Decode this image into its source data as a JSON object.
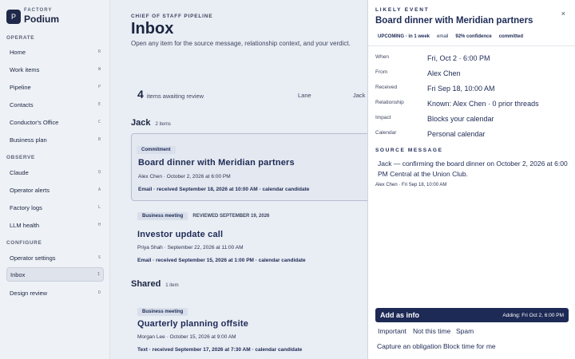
{
  "brand": {
    "logo": "P",
    "kicker": "FACTORY",
    "name": "Podium"
  },
  "sidebar": {
    "operate_label": "OPERATE",
    "observe_label": "OBSERVE",
    "configure_label": "CONFIGURE",
    "items": [
      {
        "label": "Home",
        "key": "R"
      },
      {
        "label": "Work items",
        "key": "W"
      },
      {
        "label": "Pipeline",
        "key": "P"
      },
      {
        "label": "Contacts",
        "key": "E"
      },
      {
        "label": "Conductor's Office",
        "key": "C"
      },
      {
        "label": "Business plan",
        "key": "B"
      },
      {
        "label": "Claude",
        "key": "Q"
      },
      {
        "label": "Operator alerts",
        "key": "A"
      },
      {
        "label": "Factory logs",
        "key": "L"
      },
      {
        "label": "LLM health",
        "key": "H"
      },
      {
        "label": "Operator settings",
        "key": "S"
      },
      {
        "label": "Inbox",
        "key": "I"
      },
      {
        "label": "Design review",
        "key": "D"
      }
    ]
  },
  "main": {
    "kicker": "CHIEF OF STAFF PIPELINE",
    "title": "Inbox",
    "subtitle": "Open any item for the source message, relationship context, and your verdict.",
    "count": "4",
    "count_label": "items awaiting review",
    "col_lane": "Lane",
    "col_jack": "Jack n",
    "groups": {
      "jack": {
        "title": "Jack",
        "count": "2 items"
      },
      "shared": {
        "title": "Shared",
        "count": "1 item"
      }
    },
    "cards": [
      {
        "tag": "Commitment",
        "reviewed": "",
        "title": "Board dinner with Meridian partners",
        "meta": "Alex Chen · October 2, 2026 at 6:00 PM",
        "line": "Email · received September 18, 2026 at 10:00 AM · calendar candidate"
      },
      {
        "tag": "Business meeting",
        "reviewed": "REVIEWED SEPTEMBER 19, 2026",
        "title": "Investor update call",
        "meta": "Priya Shah · September 22, 2026 at 11:00 AM",
        "line": "Email · received September 15, 2026 at 1:00 PM · calendar candidate"
      },
      {
        "tag": "Business meeting",
        "reviewed": "",
        "title": "Quarterly planning offsite",
        "meta": "Morgan Lee · October 15, 2026 at 9:00 AM",
        "line": "Text · received September 17, 2026 at 7:30 AM · calendar candidate"
      }
    ]
  },
  "drawer": {
    "close": "×",
    "kicker": "LIKELY EVENT",
    "title": "Board dinner with Meridian partners",
    "chips": [
      "UPCOMING · in 1 week",
      "email",
      "92% confidence",
      "committed"
    ],
    "fields": [
      {
        "label": "When",
        "value": "Fri, Oct 2 · 6:00 PM"
      },
      {
        "label": "From",
        "value": "Alex Chen"
      },
      {
        "label": "Received",
        "value": "Fri Sep 18, 10:00 AM"
      },
      {
        "label": "Relationship",
        "value": "Known: Alex Chen · 0 prior threads"
      },
      {
        "label": "Impact",
        "value": "Blocks your calendar"
      },
      {
        "label": "Calendar",
        "value": "Personal calendar"
      }
    ],
    "source_label": "SOURCE MESSAGE",
    "source_body": "Jack — confirming the board dinner on October 2, 2026 at 6:00 PM Central at the Union Club.",
    "source_meta": "Alex Chen · Fri Sep 18, 10:00 AM",
    "add_label": "Add as info",
    "add_hint": "Adding: Fri Oct 2, 6:00 PM",
    "actions": [
      "Important",
      "Not this time",
      "Spam",
      "Capture an obligation",
      "Block time for me"
    ]
  }
}
